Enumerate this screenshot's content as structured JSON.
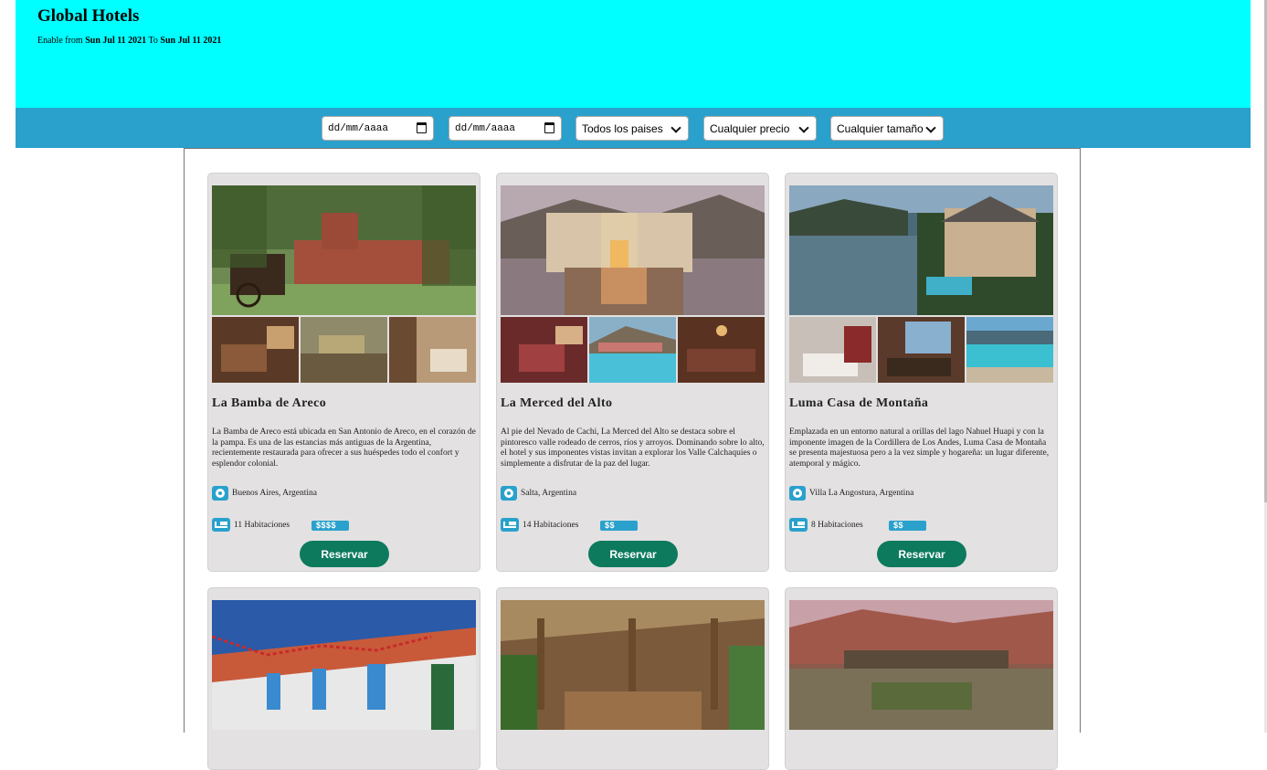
{
  "header": {
    "title": "Global Hotels",
    "enable_prefix": "Enable from ",
    "date_from": "Sun Jul 11 2021",
    "to_word": " To ",
    "date_to": "Sun Jul 11 2021",
    "bg_color": "#00ffff"
  },
  "filters": {
    "bg_color": "#2aa1cc",
    "date_from_placeholder": "dd/mm/aaaa",
    "date_to_placeholder": "dd/mm/aaaa",
    "country": "Todos los paises",
    "price": "Cualquier precio",
    "size": "Cualquier tamaño"
  },
  "hotels": [
    {
      "name": "La Bamba de Areco",
      "description": "La Bamba de Areco está ubicada en San Antonio de Areco, en el corazón de la pampa. Es una de las estancias más antiguas de la Argentina, recientemente restaurada para ofrecer a sus huéspedes todo el confort y esplendor colonial.",
      "location": "Buenos Aires, Argentina",
      "rooms": "11 Habitaciones",
      "price": "$$$$",
      "button": "Reservar"
    },
    {
      "name": "La Merced del Alto",
      "description": "Al pie del Nevado de Cachi, La Merced del Alto se destaca sobre el pintoresco valle rodeado de cerros, ríos y arroyos. Dominando sobre lo alto, el hotel y sus imponentes vistas invitan a explorar los Valle Calchaquíes o simplemente a disfrutar de la paz del lugar.",
      "location": "Salta, Argentina",
      "rooms": "14 Habitaciones",
      "price": "$$",
      "button": "Reservar"
    },
    {
      "name": "Luma Casa de Montaña",
      "description": "Emplazada en un entorno natural a orillas del lago Nahuel Huapi y con la imponente imagen de la Cordillera de Los Andes, Luma Casa de Montaña se presenta majestuosa pero a la vez simple y hogareña: un lugar diferente, atemporal y mágico.",
      "location": "Villa La Angostura, Argentina",
      "rooms": "8 Habitaciones",
      "price": "$$",
      "button": "Reservar"
    }
  ],
  "colors": {
    "card_bg": "#e3e1e1",
    "accent": "#2aa1cc",
    "button": "#0d7a5e"
  }
}
